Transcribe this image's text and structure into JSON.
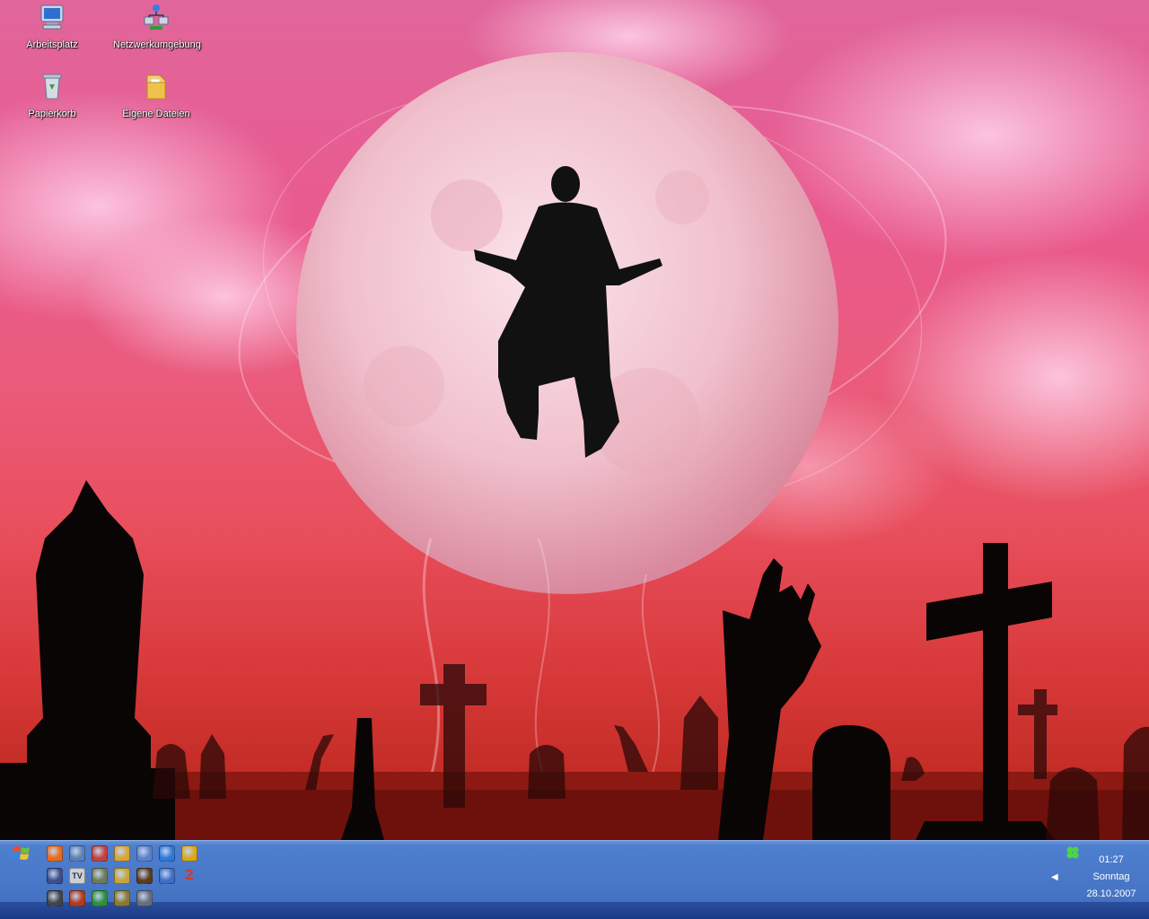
{
  "desktop": {
    "icons": [
      {
        "label": "Arbeitsplatz",
        "icon": "my-computer-icon"
      },
      {
        "label": "Netzwerkumgebung",
        "icon": "network-places-icon"
      },
      {
        "label": "Papierkorb",
        "icon": "recycle-bin-icon"
      },
      {
        "label": "Eigene Dateien",
        "icon": "my-documents-folder-icon"
      }
    ],
    "wallpaper": {
      "description_tokens": [
        "moon",
        "silhouette-figure",
        "graveyard",
        "zombie-hands"
      ],
      "accent_colors": {
        "sky_top": "#e0669b",
        "sky_bottom": "#b62418",
        "moon": "#f4c6d2"
      }
    }
  },
  "taskbar": {
    "start_icon": "windows-flag-icon",
    "quick_launch": [
      "firefox-icon",
      "globe-icon",
      "ie-icon",
      "app-pencil-icon",
      "app-round-icon",
      "media-player-icon",
      "app-smiley-icon",
      "app-planet-icon",
      "tv-icon",
      "image-viewer-icon",
      "notepad-icon",
      "app-dark-icon",
      "app-person-icon",
      "number-two-icon",
      "app-wolf-icon",
      "app-square-icon",
      "app-green-bar-icon",
      "app-bug-icon",
      "app-crest-icon"
    ],
    "quick_launch_colors": [
      "#e96a1c",
      "#5c7fb5",
      "#c2413d",
      "#d9a534",
      "#5b82c9",
      "#2e78d8",
      "#d8a71c",
      "#3b4d8c",
      "#cfcfcf",
      "#6b7b59",
      "#c6a63a",
      "#5b3b1c",
      "#3a6ec7",
      "#d24a2a",
      "#444444",
      "#b23b1a",
      "#2f8f3a",
      "#8a7a2a",
      "#666e7a"
    ],
    "tray": {
      "expand_icon": "chevron-left-icon",
      "clover_icon": "clover-icon",
      "time": "01:27",
      "day": "Sonntag",
      "date": "28.10.2007"
    },
    "colors": {
      "bar": "#4876c6",
      "bar_bottom": "#1c3b86"
    }
  }
}
